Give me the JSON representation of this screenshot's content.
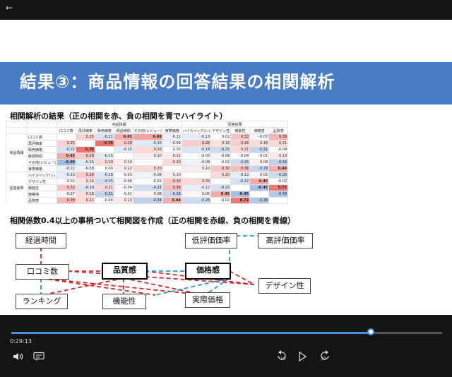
{
  "player": {
    "back_icon": "arrow-left-icon",
    "time_elapsed": "0:29:13",
    "progress_fraction": 0.834,
    "skip_back_label": "10",
    "skip_forward_label": "30",
    "volume_icon": "speaker-icon",
    "captions_icon": "captions-icon",
    "play_icon": "play-icon",
    "accent_color": "#4a90e2"
  },
  "slide": {
    "title": "結果③：商品情報の回答結果の相関解析",
    "section1": "相関解析の結果（正の相関を赤、負の相関を青でハイライト）",
    "section2": "相関係数0.4以上の事柄ついて相関図を作成（正の相関を赤線、負の相関を青線）",
    "banner_color": "#4a7cc6"
  },
  "table": {
    "group_col1": "商品情報",
    "group_col2": "回答結果",
    "group_row1": "商品情報",
    "group_row2": "回答結果",
    "columns": [
      "口コミ数",
      "再評価率",
      "販売価格",
      "経過時間",
      "その他(レビュー)",
      "実際価格",
      "ハイスペック(レ)",
      "デザイン性",
      "機能性",
      "価格感",
      "品質感"
    ],
    "rows": [
      {
        "label": "口コミ数",
        "cells": [
          "",
          "0.25",
          "-0.21",
          "0.43",
          "0.49",
          "-0.11",
          "-0.13",
          "0.02",
          "0.32",
          "-0.07",
          "0.39"
        ]
      },
      {
        "label": "再評価率",
        "cells": [
          "0.25",
          "",
          "0.76",
          "0.28",
          "-0.16",
          "-0.09",
          "0.28",
          "0.16",
          "0.26",
          "0.18",
          "0.21"
        ]
      },
      {
        "label": "販売価格",
        "cells": [
          "-0.21",
          "0.76",
          "",
          "-0.15",
          "0.20",
          "0.00",
          "-0.18",
          "-0.25",
          "0.21",
          "-0.31",
          "-0.04"
        ]
      },
      {
        "label": "経過時間",
        "cells": [
          "0.43",
          "0.28",
          "-0.15",
          "",
          "0.10",
          "0.12",
          "-0.03",
          "-0.06",
          "-0.04",
          "-0.01",
          "0.13"
        ]
      },
      {
        "label": "その他(レビュー)",
        "cells": [
          "-0.49",
          "-0.16",
          "0.20",
          "0.10",
          "",
          "0.20",
          "-0.08",
          "-0.02",
          "-0.25",
          "0.08",
          "-0.34"
        ]
      },
      {
        "label": "実際価格",
        "cells": [
          "-0.11",
          "-0.09",
          "0.00",
          "0.12",
          "0.20",
          "",
          "0.10",
          "0.30",
          "0.36",
          "-0.29",
          "0.44"
        ]
      },
      {
        "label": "ハイスペック(レ)",
        "cells": [
          "-0.13",
          "0.28",
          "-0.18",
          "-0.03",
          "-0.08",
          "0.10",
          "",
          "0.20",
          "-0.12",
          "0.05",
          "-0.26"
        ]
      },
      {
        "label": "デザイン性",
        "cells": [
          "0.02",
          "0.16",
          "-0.25",
          "-0.06",
          "-0.02",
          "0.30",
          "0.20",
          "",
          "-0.22",
          "0.45",
          "-0.02"
        ]
      },
      {
        "label": "機能性",
        "cells": [
          "0.32",
          "-0.20",
          "0.21",
          "-0.04",
          "-0.25",
          "0.36",
          "-0.12",
          "-0.22",
          "",
          "-0.45",
          "0.73"
        ]
      },
      {
        "label": "価格感",
        "cells": [
          "-0.07",
          "0.18",
          "-0.31",
          "-0.01",
          "0.08",
          "-0.29",
          "0.05",
          "0.45",
          "-0.45",
          "",
          "-0.39"
        ]
      },
      {
        "label": "品質感",
        "cells": [
          "0.39",
          "0.21",
          "-0.04",
          "0.13",
          "-0.34",
          "0.44",
          "-0.26",
          "-0.02",
          "0.73",
          "-0.39",
          ""
        ]
      }
    ],
    "positive_color": "#e8504a",
    "negative_color": "#4a7cc6"
  },
  "diagram": {
    "nodes": {
      "elapsed": "経過時間",
      "low_rating": "低評価価率",
      "high_rating": "高評価価率",
      "reviews": "口コミ数",
      "quality": "品質感",
      "price_feel": "価格感",
      "design": "デザイン性",
      "ranking": "ランキング",
      "function": "機能性",
      "actual_price": "実際価格"
    },
    "positive_line_color": "#d62728",
    "negative_line_color": "#1f9bd1"
  }
}
